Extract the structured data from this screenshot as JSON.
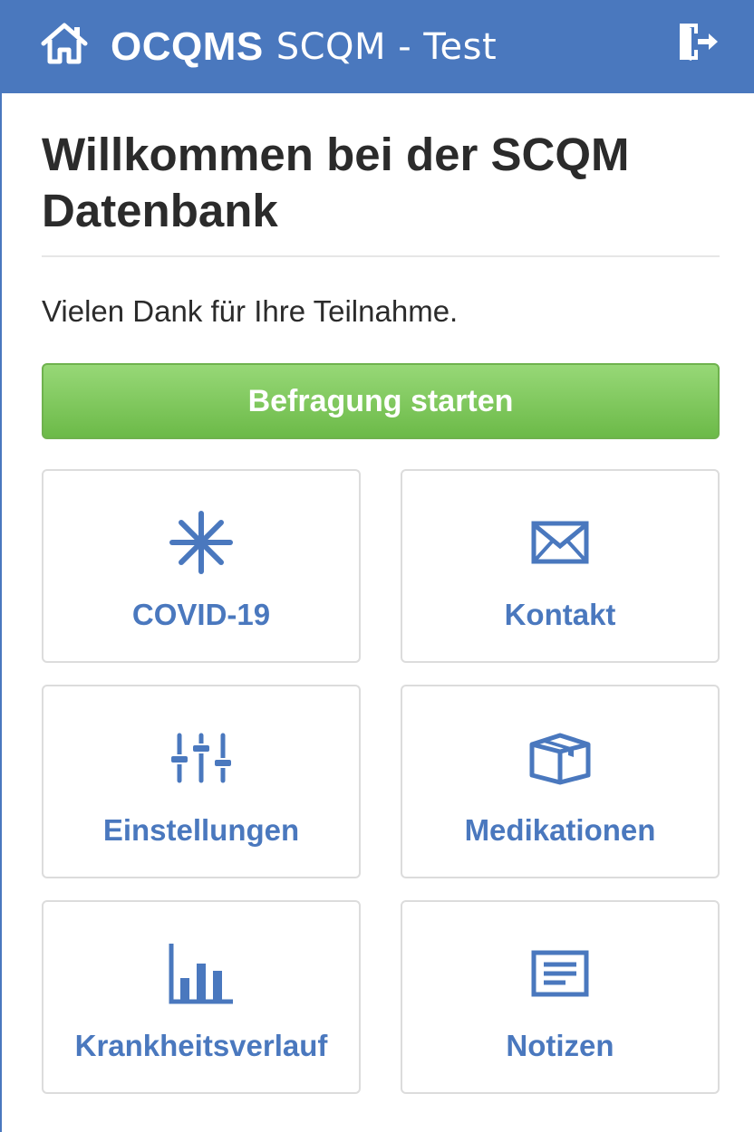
{
  "header": {
    "brand_bold": "OCQMS",
    "brand_light": "SCQM - Test",
    "home_icon": "home-icon",
    "logout_icon": "logout-icon",
    "color": "#4a78be"
  },
  "main": {
    "title": "Willkommen bei der SCQM Datenbank",
    "intro": "Vielen Dank für Ihre Teilnahme.",
    "start_button": "Befragung starten"
  },
  "tiles": [
    {
      "label": "COVID-19",
      "icon": "virus-asterisk-icon"
    },
    {
      "label": "Kontakt",
      "icon": "envelope-icon"
    },
    {
      "label": "Einstellungen",
      "icon": "sliders-icon"
    },
    {
      "label": "Medikationen",
      "icon": "box-icon"
    },
    {
      "label": "Krankheitsverlauf",
      "icon": "bar-chart-icon"
    },
    {
      "label": "Notizen",
      "icon": "notes-icon"
    }
  ],
  "colors": {
    "accent": "#4a78be",
    "button_green": "#7cc35a",
    "text": "#2b2b2b"
  }
}
